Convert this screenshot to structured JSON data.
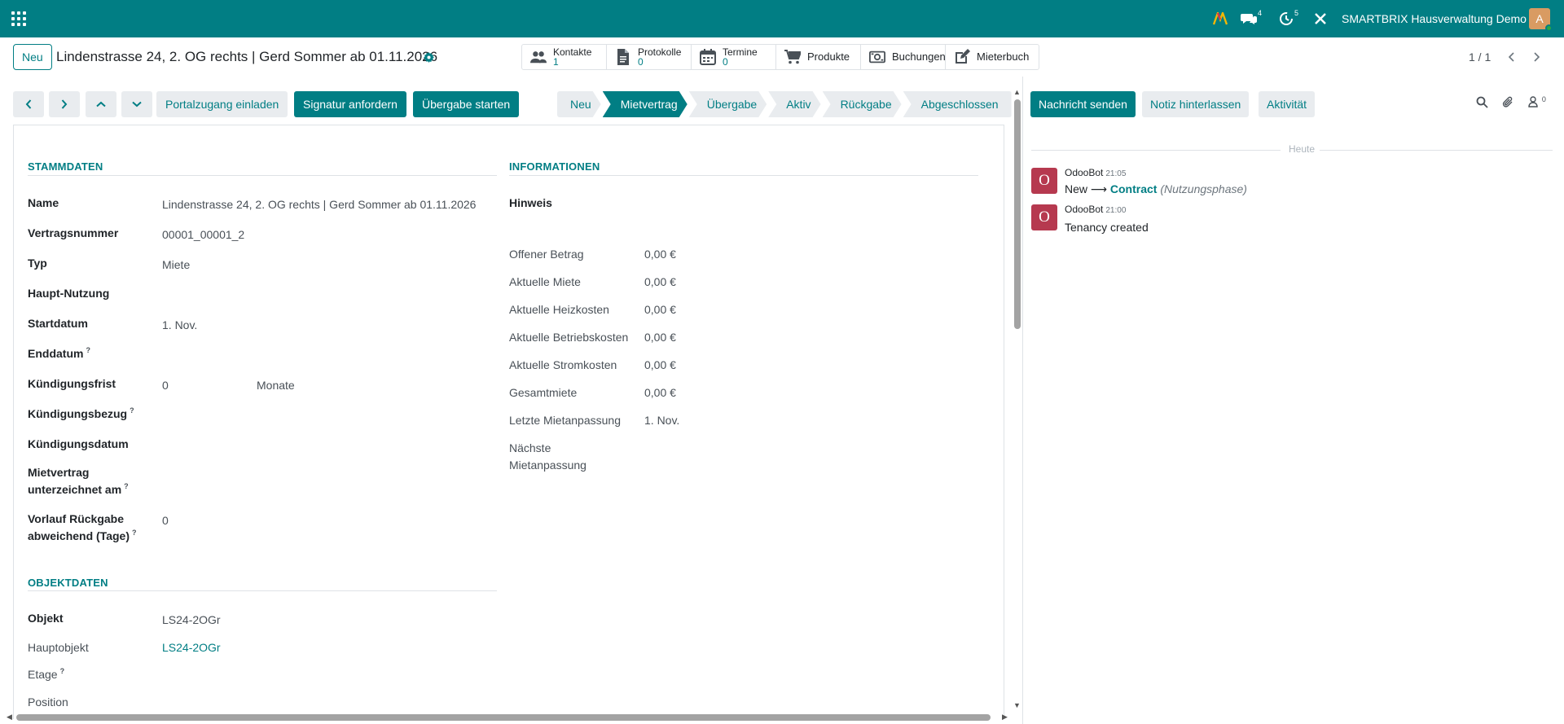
{
  "topbar": {
    "company": "SMARTBRIX Hausverwaltung Demo",
    "messages_count": "4",
    "activities_count": "5",
    "avatar_letter": "A",
    "accent": "#017e84"
  },
  "header": {
    "new_button": "Neu",
    "record_title": "Lindenstrasse 24, 2. OG rechts | Gerd Sommer ab 01.11.2026",
    "pager": "1 / 1",
    "smart_buttons": [
      {
        "label": "Kontakte",
        "count": "1",
        "icon": "users-icon"
      },
      {
        "label": "Protokolle",
        "count": "0",
        "icon": "document-icon"
      },
      {
        "label": "Termine",
        "count": "0",
        "icon": "calendar-icon"
      },
      {
        "label": "Produkte",
        "icon": "cart-icon"
      },
      {
        "label": "Buchungen",
        "icon": "money-icon"
      },
      {
        "label": "Mieterbuch",
        "icon": "edit-icon"
      }
    ]
  },
  "actions": {
    "portal": "Portalzugang einladen",
    "signature": "Signatur anfordern",
    "handover": "Übergabe starten"
  },
  "statusbar": {
    "stages": [
      "Neu",
      "Mietvertrag",
      "Übergabe",
      "Aktiv",
      "Rückgabe",
      "Abgeschlossen"
    ],
    "active": "Mietvertrag"
  },
  "form": {
    "stammdaten_title": "STAMMDATEN",
    "informationen_title": "INFORMATIONEN",
    "objektdaten_title": "OBJEKTDATEN",
    "stammdaten": {
      "name_label": "Name",
      "name_value": "Lindenstrasse 24, 2. OG rechts | Gerd Sommer ab 01.11.2026",
      "vertragsnummer_label": "Vertragsnummer",
      "vertragsnummer_value": "00001_00001_2",
      "typ_label": "Typ",
      "typ_value": "Miete",
      "haupt_nutzung_label": "Haupt-Nutzung",
      "startdatum_label": "Startdatum",
      "startdatum_value": "1. Nov.",
      "enddatum_label": "Enddatum",
      "kuendigungsfrist_label": "Kündigungsfrist",
      "kuendigungsfrist_value": "0",
      "kuendigungsfrist_unit": "Monate",
      "kuendigungsbezug_label": "Kündigungsbezug",
      "kuendigungsdatum_label": "Kündigungsdatum",
      "mietvertrag_label_1": "Mietvertrag",
      "mietvertrag_label_2": "unterzeichnet am",
      "vorlauf_label_1": "Vorlauf Rückgabe",
      "vorlauf_label_2": "abweichend (Tage)",
      "vorlauf_value": "0",
      "help_mark": "?"
    },
    "informationen": {
      "hinweis_label": "Hinweis",
      "offener_betrag_label": "Offener Betrag",
      "offener_betrag_value": "0,00 €",
      "aktuelle_miete_label": "Aktuelle Miete",
      "aktuelle_miete_value": "0,00 €",
      "heizkosten_label": "Aktuelle Heizkosten",
      "heizkosten_value": "0,00 €",
      "betriebskosten_label": "Aktuelle Betriebskosten",
      "betriebskosten_value": "0,00 €",
      "stromkosten_label": "Aktuelle Stromkosten",
      "stromkosten_value": "0,00 €",
      "gesamtmiete_label": "Gesamtmiete",
      "gesamtmiete_value": "0,00 €",
      "letzte_label": "Letzte Mietanpassung",
      "letzte_value": "1. Nov.",
      "naechste_label_1": "Nächste",
      "naechste_label_2": "Mietanpassung"
    },
    "objektdaten": {
      "objekt_label": "Objekt",
      "objekt_value": "LS24-2OGr",
      "hauptobjekt_label": "Hauptobjekt",
      "hauptobjekt_value": "LS24-2OGr",
      "etage_label": "Etage",
      "position_label": "Position"
    }
  },
  "chatter": {
    "send_message": "Nachricht senden",
    "log_note": "Notiz hinterlassen",
    "activity": "Aktivität",
    "followers_count": "0",
    "day": "Heute",
    "messages": [
      {
        "avatar": "O",
        "author": "OdooBot",
        "time": "21:05",
        "old": "New",
        "arrow": "⟶",
        "new": "Contract",
        "field": "(Nutzungsphase)"
      },
      {
        "avatar": "O",
        "author": "OdooBot",
        "time": "21:00",
        "body": "Tenancy created"
      }
    ]
  }
}
